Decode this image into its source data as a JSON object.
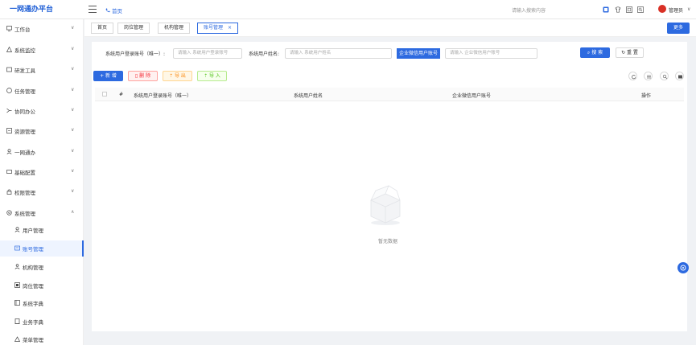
{
  "app": {
    "title": "一网通办平台"
  },
  "header": {
    "home_label": "首页",
    "search_placeholder": "请输入搜索内容",
    "user_name": "管理员",
    "caret": "∨"
  },
  "sidebar": {
    "items": [
      {
        "label": "工作台",
        "icon": "monitor-icon",
        "caret": "∨"
      },
      {
        "label": "系统监控",
        "icon": "monitor-icon",
        "caret": "∨"
      },
      {
        "label": "研发工具",
        "icon": "tool-icon",
        "caret": "∨"
      },
      {
        "label": "任务管理",
        "icon": "task-icon",
        "caret": "∨"
      },
      {
        "label": "协同办公",
        "icon": "collab-icon",
        "caret": "∨"
      },
      {
        "label": "资源管理",
        "icon": "resource-icon",
        "caret": "∨"
      },
      {
        "label": "一网通办",
        "icon": "user-icon",
        "caret": "∨"
      },
      {
        "label": "基础配置",
        "icon": "config-icon",
        "caret": "∨"
      },
      {
        "label": "权限管理",
        "icon": "lock-icon",
        "caret": "∨"
      },
      {
        "label": "系统管理",
        "icon": "gear-icon",
        "caret": "∧"
      }
    ],
    "sub_items": [
      {
        "label": "用户管理",
        "icon": "user-icon",
        "active": false
      },
      {
        "label": "账号管理",
        "icon": "id-card-icon",
        "active": true
      },
      {
        "label": "机构管理",
        "icon": "org-icon",
        "active": false
      },
      {
        "label": "岗位管理",
        "icon": "post-icon",
        "active": false
      },
      {
        "label": "系统字典",
        "icon": "dict-icon",
        "active": false
      },
      {
        "label": "业务字典",
        "icon": "book-icon",
        "active": false
      },
      {
        "label": "菜单管理",
        "icon": "menu-icon",
        "active": false
      }
    ]
  },
  "tabs": [
    {
      "label": "首页"
    },
    {
      "label": "岗位管理"
    },
    {
      "label": "机构管理"
    },
    {
      "label": "账号管理",
      "close": "×"
    }
  ],
  "more_label": "更多",
  "filters": {
    "login_label": "系统用户登录账号（唯一）:",
    "login_placeholder": "请输入 系统用户登录账号",
    "name_label": "系统用户姓名:",
    "name_placeholder": "请输入 系统用户姓名",
    "wechat_label": "企业微信用户账号",
    "wechat_placeholder": "请输入 企业微信用户账号",
    "search_label": "搜 索",
    "reset_label": "重 置"
  },
  "actions": {
    "add": "+ 新 增",
    "delete": "删 除",
    "export": "导 出",
    "import": "导 入"
  },
  "table": {
    "columns": [
      "#",
      "系统用户登录账号（唯一）",
      "系统用户姓名",
      "企业微信用户账号",
      "操作"
    ],
    "empty_text": "暂无数据"
  },
  "colors": {
    "primary": "#2d6ae0",
    "danger": "#f5222d",
    "warning": "#fa8c16",
    "success": "#52c41a"
  }
}
